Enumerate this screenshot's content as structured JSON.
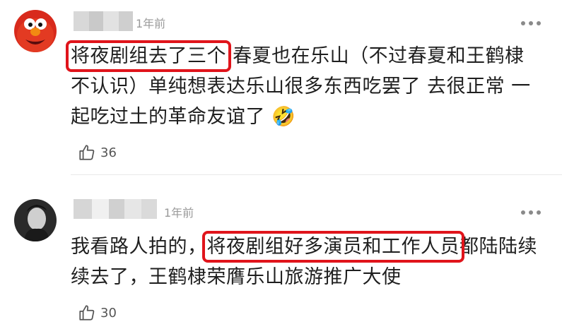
{
  "comments": [
    {
      "time": "1年前",
      "text_before": "",
      "highlight": "将夜剧组去了三个",
      "text_after": "春夏也在乐山（不过春夏和王鹤棣不认识）单纯想表达乐山很多东西吃罢了 去很正常 一起吃过土的革命友谊了",
      "emoji": "🤣",
      "likes": "36",
      "avatar_icon": "elmo-avatar-icon"
    },
    {
      "time": "1年前",
      "text_before": "我看路人拍的，",
      "highlight": "将夜剧组好多演员和工作人员",
      "text_after": "都陆陆续续去了，王鹤棣荣膺乐山旅游推广大使",
      "emoji": "",
      "likes": "30",
      "avatar_icon": "portrait-avatar-icon"
    }
  ],
  "colors": {
    "highlight_border": "#e0141b",
    "muted": "#9a9a9a"
  }
}
